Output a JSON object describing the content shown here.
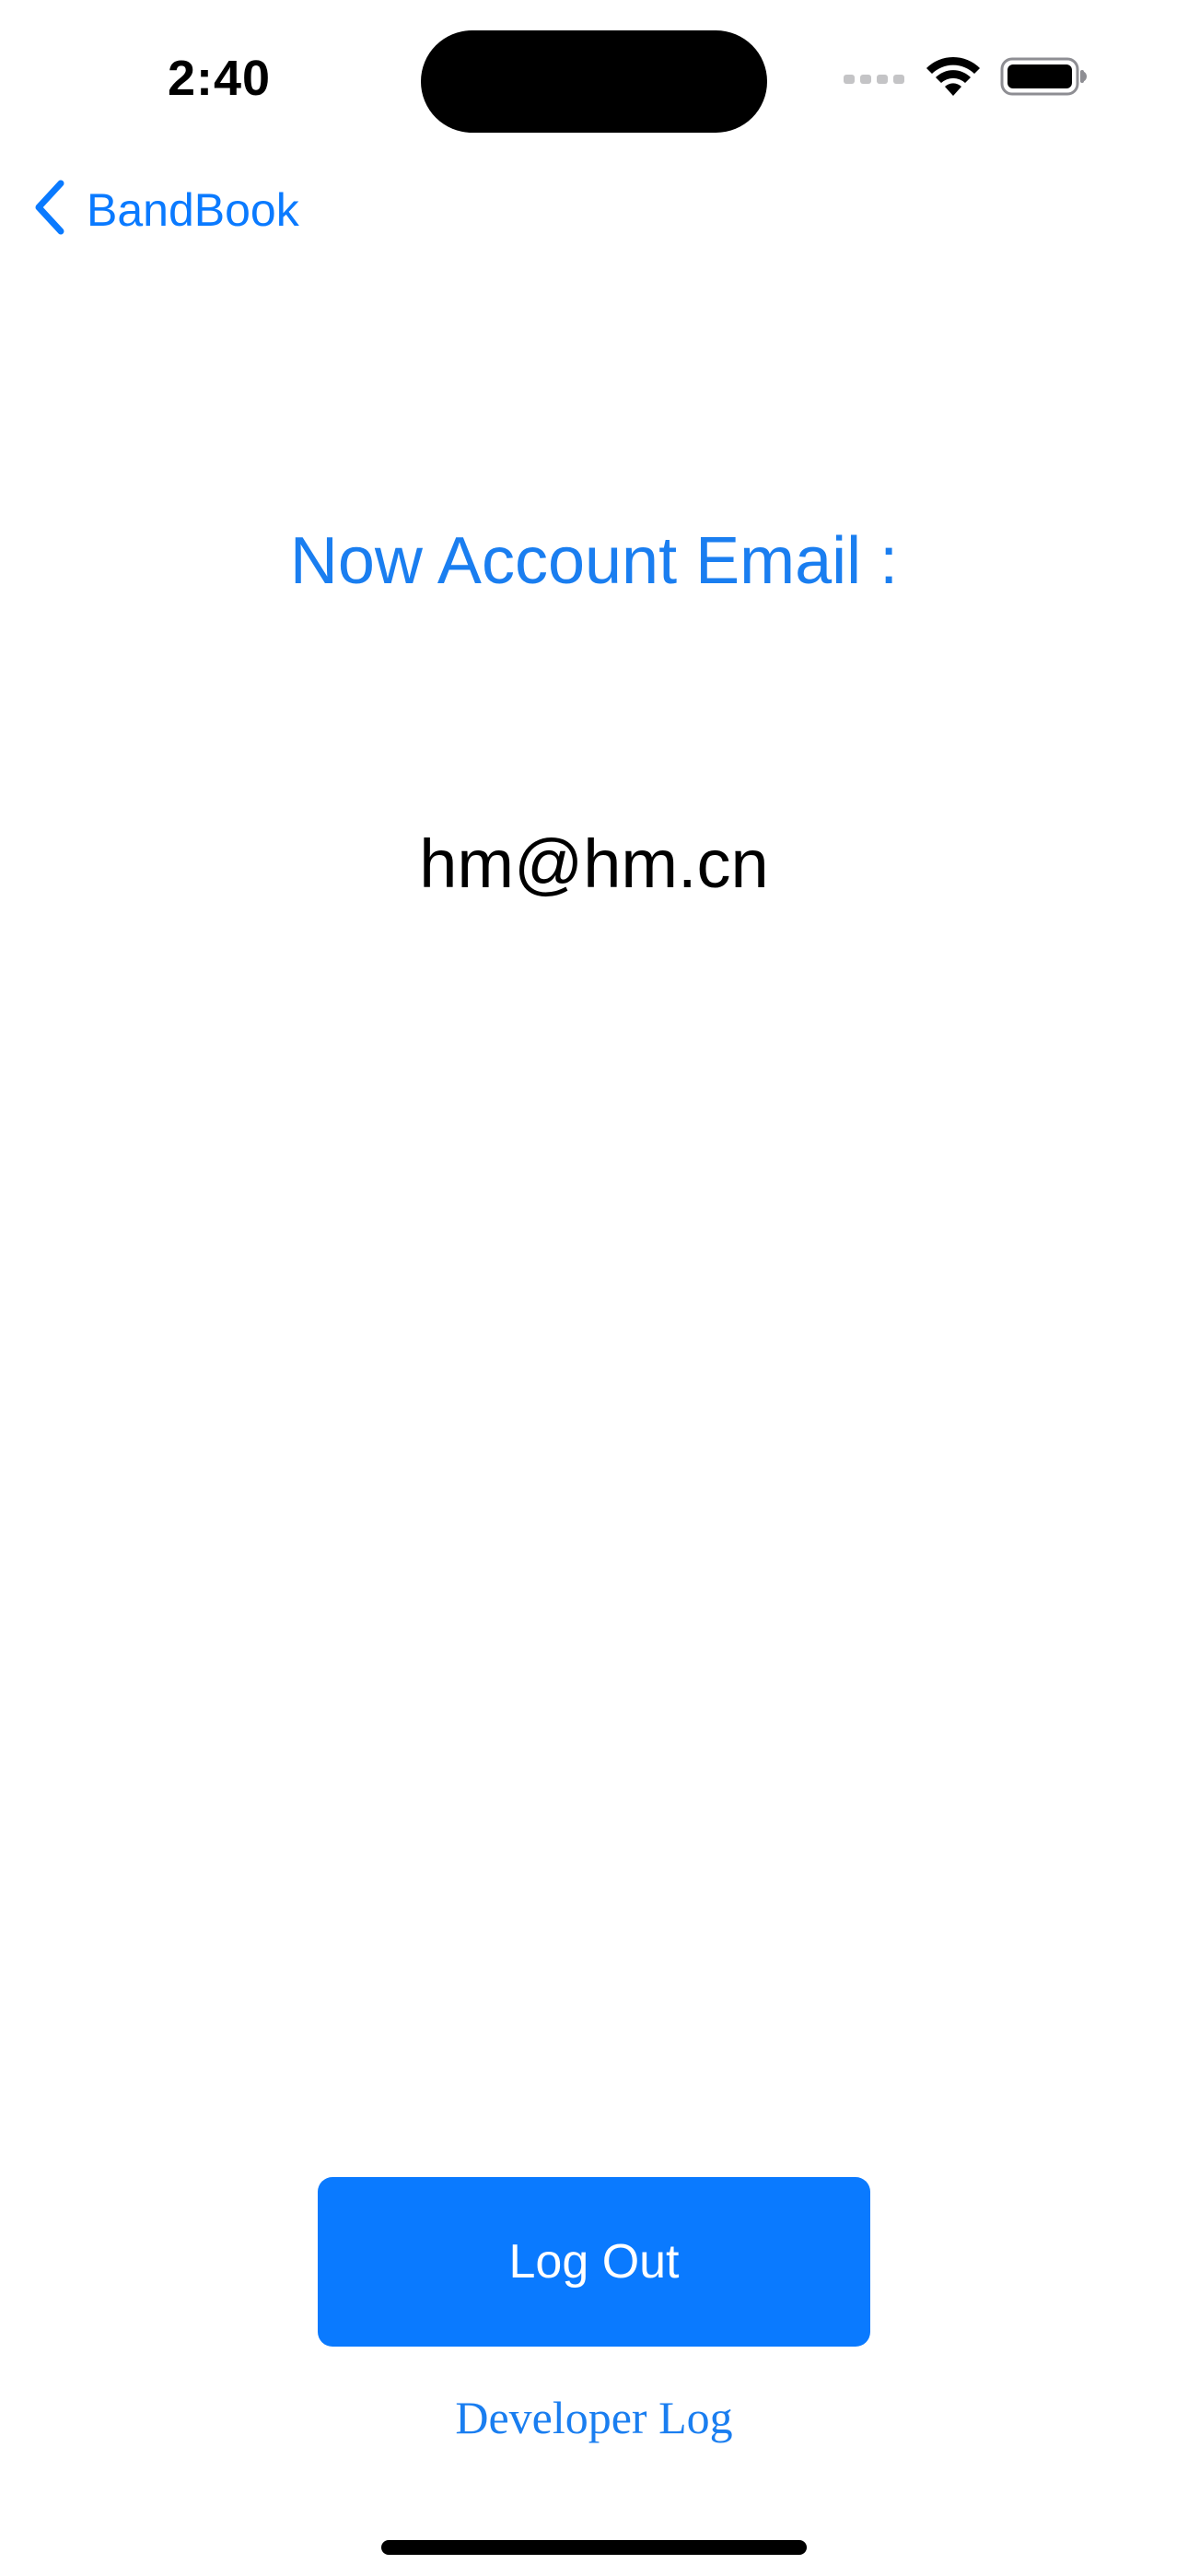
{
  "status_bar": {
    "time": "2:40",
    "icons": [
      "cellular-signal-icon",
      "wifi-icon",
      "battery-icon"
    ]
  },
  "nav": {
    "back_label": "BandBook",
    "back_icon": "chevron-left-icon"
  },
  "account": {
    "title": "Now Account Email :",
    "email": "hm@hm.cn"
  },
  "actions": {
    "logout_label": "Log Out",
    "developer_log_label": "Developer Log"
  },
  "colors": {
    "accent": "#0a7aff",
    "text": "#000000",
    "background": "#ffffff"
  }
}
